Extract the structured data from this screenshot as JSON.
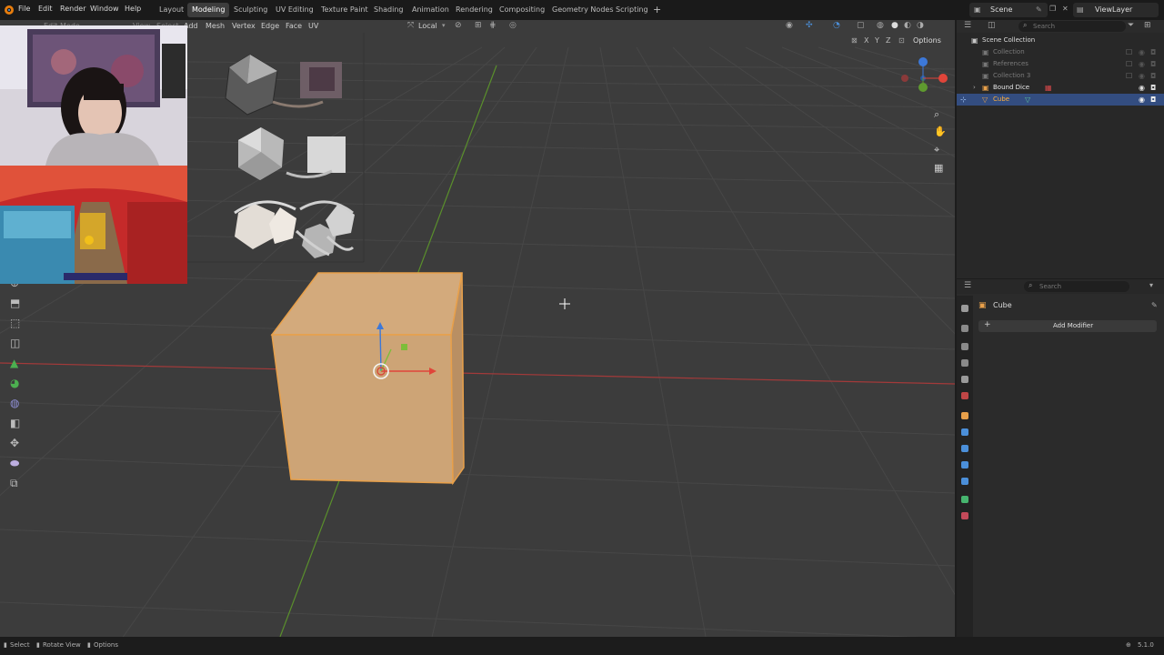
{
  "topbar": {
    "menus": [
      "File",
      "Edit",
      "Render",
      "Window",
      "Help"
    ],
    "workspaces": [
      "Layout",
      "Modeling",
      "Sculpting",
      "UV Editing",
      "Texture Paint",
      "Shading",
      "Animation",
      "Rendering",
      "Compositing",
      "Geometry Nodes",
      "Scripting"
    ],
    "active_workspace": "Modeling",
    "scene_label": "Scene",
    "viewlayer_label": "ViewLayer"
  },
  "viewport": {
    "mode": "Edit Mode",
    "menus": [
      "View",
      "Select",
      "Add",
      "Mesh",
      "Vertex",
      "Edge",
      "Face",
      "UV"
    ],
    "transform_orientation": "Local",
    "options_label": "Options"
  },
  "outliner": {
    "search_placeholder": "Search",
    "root": "Scene Collection",
    "items": [
      {
        "label": "Collection",
        "dim": true
      },
      {
        "label": "References",
        "dim": true
      },
      {
        "label": "Collection 3",
        "dim": true
      },
      {
        "label": "Bound Dice",
        "dim": false
      },
      {
        "label": "Cube",
        "dim": false,
        "selected": true
      }
    ]
  },
  "properties": {
    "search_placeholder": "Search",
    "object_name": "Cube",
    "add_modifier_label": "Add Modifier"
  },
  "statusbar": {
    "select_label": "Select",
    "rotate_label": "Rotate View",
    "options_label": "Options",
    "version": "5.1.0"
  },
  "colors": {
    "accent": "#4772b3",
    "selection_orange": "#e8a04a",
    "x_axis": "#b23a3a",
    "y_axis": "#5f9a2f",
    "viewport_bg": "#3c3c3c"
  }
}
